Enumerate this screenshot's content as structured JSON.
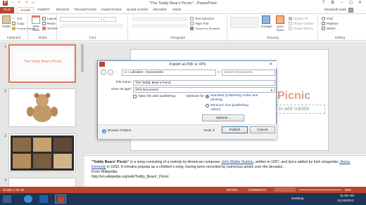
{
  "app": {
    "title": "\"The Teddy Bear's Picnic\" - PowerPoint"
  },
  "window_controls": [
    "?",
    "⧉",
    "–",
    "▢",
    "✕"
  ],
  "tabs": [
    "FILE",
    "HOME",
    "INSERT",
    "DESIGN",
    "TRANSITIONS",
    "ANIMATIONS",
    "SLIDE SHOW",
    "REVIEW",
    "VIEW"
  ],
  "user": {
    "name": "Elizabeth Nofs"
  },
  "ribbon": {
    "clipboard": {
      "paste": "Paste",
      "cut": "Cut",
      "copy": "Copy",
      "format_painter": "Format Painter",
      "label": "Clipboard"
    },
    "slides": {
      "new_slide": "New Slide",
      "layout": "Layout",
      "reset": "Reset",
      "section": "Section",
      "label": "Slides"
    },
    "font": {
      "label": "Font"
    },
    "paragraph": {
      "text_direction": "Text Direction",
      "align_text": "Align Text",
      "convert_smartart": "Convert to SmartArt",
      "label": "Paragraph"
    },
    "drawing": {
      "arrange": "Arrange",
      "quick_styles": "Quick Styles",
      "shape_fill": "Shape Fill",
      "shape_outline": "Shape Outline",
      "shape_effects": "Shape Effects",
      "label": "Drawing"
    },
    "editing": {
      "find": "Find",
      "replace": "Replace",
      "select": "Select",
      "label": "Editing"
    }
  },
  "thumbnails": [
    {
      "num": "1",
      "title": "The Teddy Bear's Picnic"
    },
    {
      "num": "2",
      "title": ""
    },
    {
      "num": "3",
      "title": ""
    },
    {
      "num": "4",
      "title": ""
    }
  ],
  "slide": {
    "title_partial": "Picnic",
    "subtitle_placeholder": "to add subtitle"
  },
  "dialog": {
    "title": "Publish as PDF or XPS",
    "breadcrumb": [
      "Libraries",
      "Documents"
    ],
    "search_placeholder": "Search Documents",
    "file_name_label": "File name:",
    "file_name_value": "The Teddy Bear's Picnic",
    "save_as_label": "Save as type:",
    "save_as_value": "XPS Document",
    "open_after": "Open file after publishing",
    "optimize_label": "Optimize for:",
    "opt_standard": "Standard (publishing online and printing)",
    "opt_minimum": "Minimum size (publishing online)",
    "options_button": "Options...",
    "browse_folders": "Browse Folders",
    "tools": "Tools",
    "publish": "Publish",
    "cancel": "Cancel"
  },
  "notes": {
    "bold_title": "\"Teddy Bears' Picnic\"",
    "text1": " is a song consisting of a melody by American composer ",
    "link1": "John Walter Bratton",
    "text2": ", written in 1907, and lyrics added by Irish songwriter ",
    "link2": "Jimmy Kennedy",
    "text3": " in 1932. It remains popular as a children's song, having been recorded by numerous artists over the decades.",
    "from": "From Wikipedia:",
    "url": "http://en.wikipedia.org/wiki/Teddy_Bears'_Picnic"
  },
  "status": {
    "slide": "SLIDE 1 OF 21",
    "notes": "NOTES",
    "comments": "COMMENTS",
    "zoom": "50%"
  },
  "taskbar": {
    "desktop": "Desktop",
    "time": "11:56 AM",
    "date": "11/16/2013"
  },
  "colors": {
    "accent": "#b7472a",
    "title_orange": "#e0785c",
    "taskbar": "#1e3458"
  }
}
